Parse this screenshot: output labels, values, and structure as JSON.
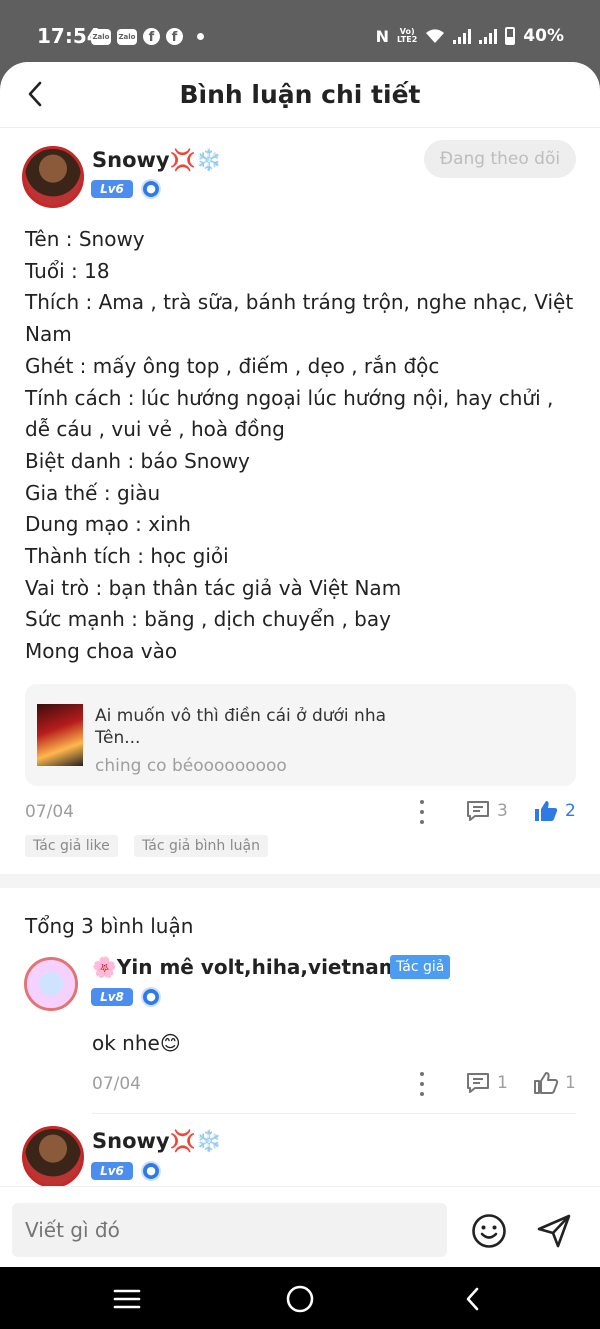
{
  "status_bar": {
    "time": "17:54",
    "left_icons": [
      "zalo-icon",
      "zalo-icon",
      "facebook-icon",
      "facebook-icon",
      "dot-icon"
    ],
    "network_label": "Vo) LTE2",
    "battery": "40%"
  },
  "header": {
    "title": "Bình luận chi tiết",
    "back_icon": "chevron-left-icon"
  },
  "post": {
    "author": "Snowy💢❄️",
    "level": "Lv6",
    "follow_label": "Đang theo dõi",
    "body": "Tên : Snowy\nTuổi : 18\nThích : Ama , trà sữa, bánh tráng trộn, nghe nhạc, Việt Nam\nGhét : mấy ông top , điếm , dẹo , rắn độc\nTính cách : lúc hướng ngoại lúc hướng nội, hay chửi , dễ cáu , vui vẻ , hoà đồng\nBiệt danh : báo Snowy\nGia thế : giàu\nDung mạo : xinh\nThành tích : học giỏi\nVai trò : bạn thân tác giả và Việt Nam\nSức mạnh : băng , dịch chuyển , bay\nMong choa vào",
    "quote": {
      "line1": "Ai muốn vô thì điền cái ở dưới nha",
      "line2": "Tên...",
      "line3": "ching co béooooooooo"
    },
    "date": "07/04",
    "comment_count": "3",
    "like_count": "2",
    "tags": [
      "Tác giả like",
      "Tác giả bình luận"
    ]
  },
  "comments": {
    "total_label": "Tổng 3 bình luận",
    "items": [
      {
        "author": "🌸Yin mê volt,hiha,vietnam🌸",
        "author_tag": "Tác giả",
        "level": "Lv8",
        "text": "ok nhe😊",
        "date": "07/04",
        "comment_count": "1",
        "like_count": "1"
      },
      {
        "author": "Snowy💢❄️",
        "level": "Lv6"
      }
    ]
  },
  "composer": {
    "placeholder": "Viết gì đó"
  },
  "colors": {
    "accent": "#2f7be6",
    "level_badge": "#4c8ef0",
    "author_tag": "#4c9cf0",
    "muted_text": "#9e9e9e"
  }
}
